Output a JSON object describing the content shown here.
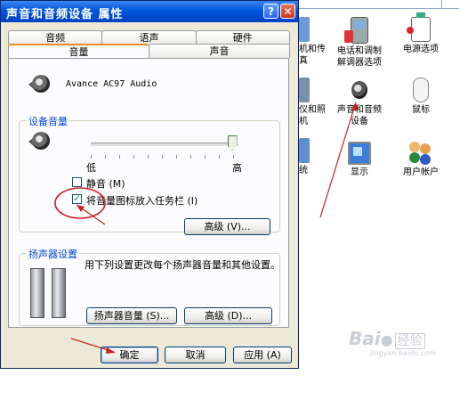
{
  "dialog": {
    "title": "声音和音频设备 属性",
    "help_glyph": "?",
    "close_glyph": "✕",
    "tabs_back": [
      "音频",
      "语声",
      "硬件"
    ],
    "tabs_front": [
      "音量",
      "声音"
    ],
    "active_tab": "音量",
    "device_name": "Avance AC97 Audio",
    "device_volume": {
      "group_title": "设备音量",
      "low_label": "低",
      "high_label": "高",
      "level": 1.0,
      "mute_label": "静音 (M)",
      "mute_checked": false,
      "tray_label": "将音量图标放入任务栏 (I)",
      "tray_checked": true,
      "advanced_button": "高级 (V)..."
    },
    "speaker_settings": {
      "group_title": "扬声器设置",
      "description": "用下列设置更改每个扬声器音量和其他设置。",
      "speaker_volume_button": "扬声器音量 (S)...",
      "advanced_button": "高级 (D)..."
    },
    "buttons": {
      "ok": "确定",
      "cancel": "取消",
      "apply": "应用 (A)"
    }
  },
  "control_panel": {
    "items": [
      {
        "label": "机和传\n真",
        "icon": "fax-icon"
      },
      {
        "label": "电话和调制\n解调器选项",
        "icon": "phone-modem-icon"
      },
      {
        "label": "电源选项",
        "icon": "power-options-icon"
      },
      {
        "label": "仪和照\n机",
        "icon": "scanner-camera-icon"
      },
      {
        "label": "声音和音频\n设备",
        "icon": "speaker-icon"
      },
      {
        "label": "鼠标",
        "icon": "mouse-icon"
      },
      {
        "label": "统",
        "icon": "system-icon"
      },
      {
        "label": "显示",
        "icon": "display-icon"
      },
      {
        "label": "用户帐户",
        "icon": "user-accounts-icon"
      }
    ]
  },
  "watermark": {
    "logo_text": "Bai",
    "logo_suffix": "经验",
    "url": "jingyan.baidu.com"
  },
  "colors": {
    "titlebar": "#0056e0",
    "dialog_bg": "#ece9d8",
    "group_title": "#0046d5",
    "annotation_red": "#c81e1e"
  }
}
